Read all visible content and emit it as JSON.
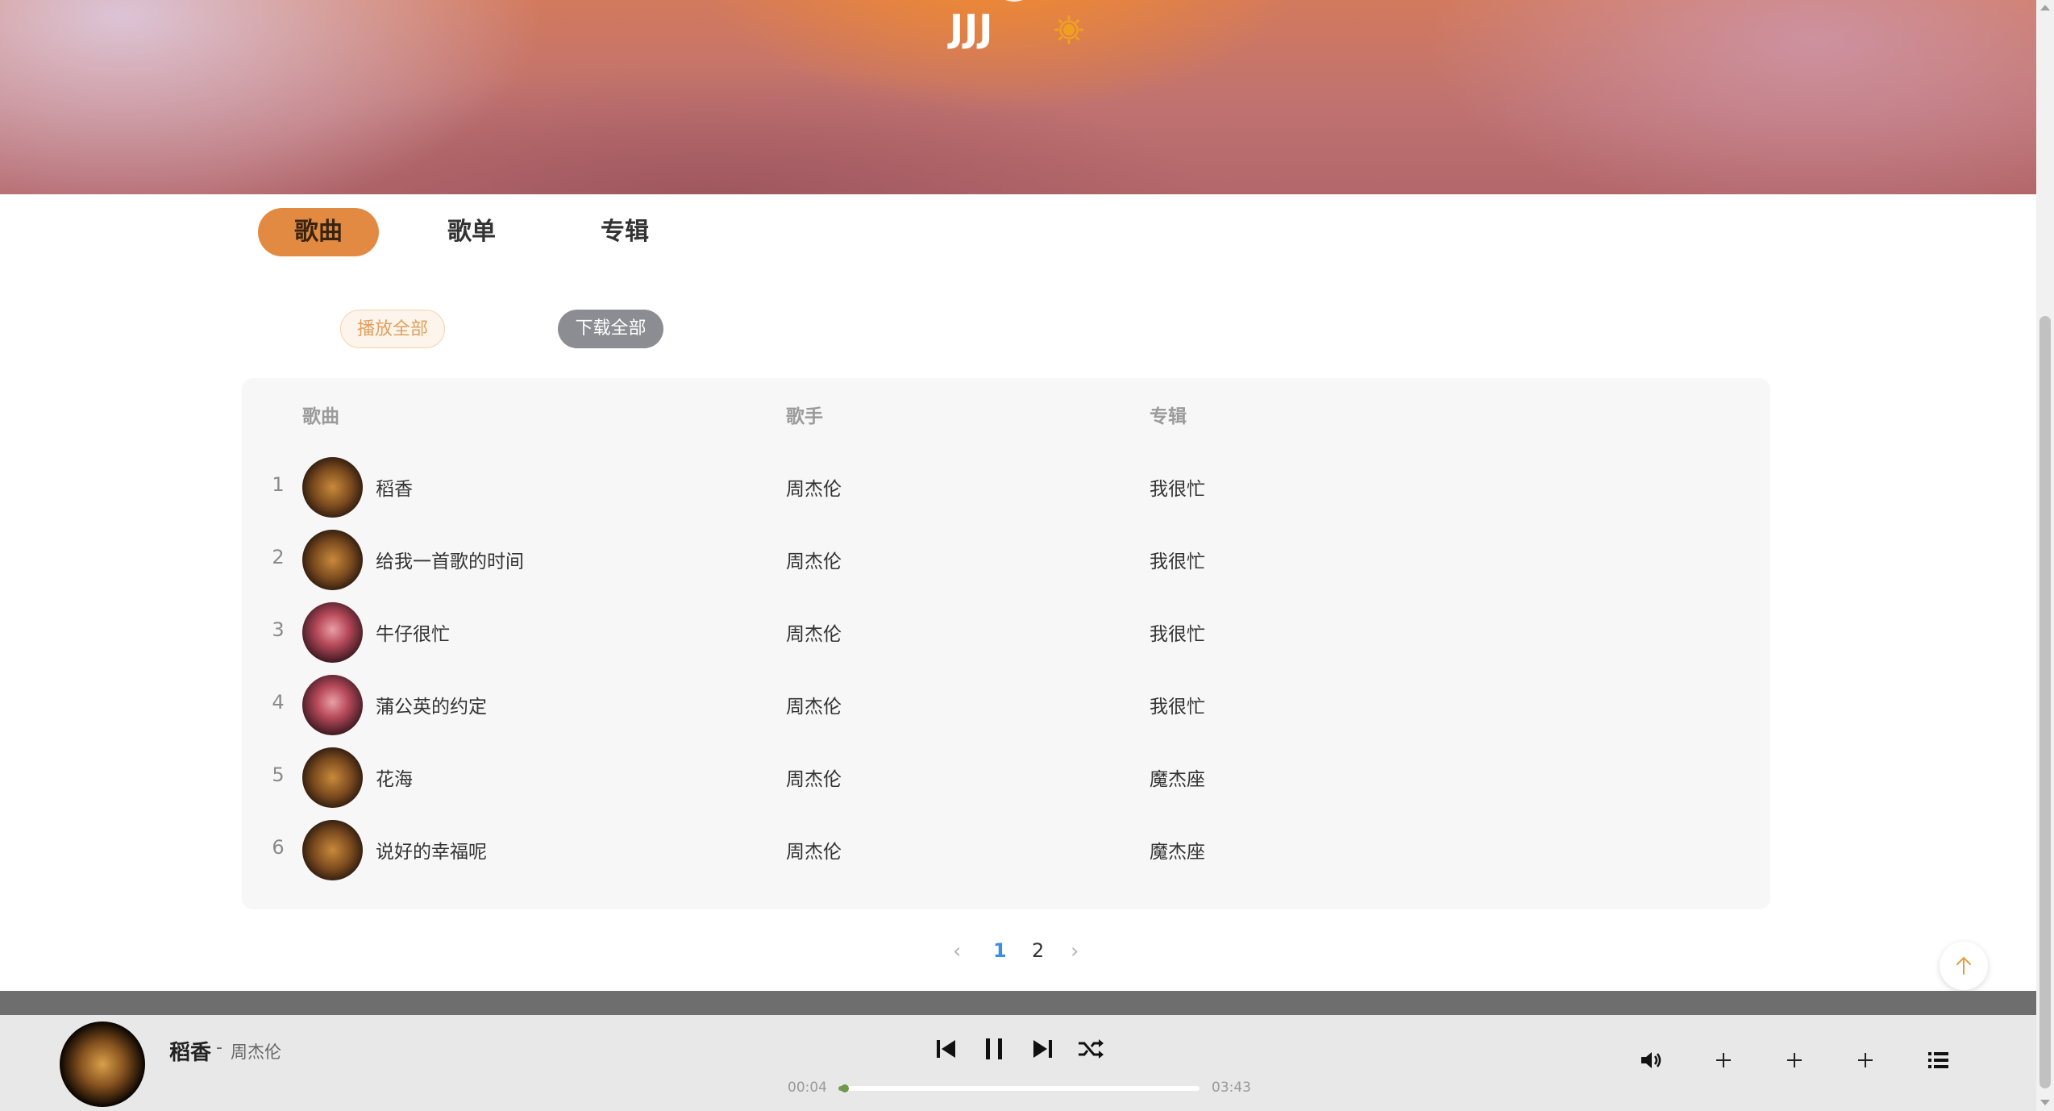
{
  "header": {
    "title": "JJJ"
  },
  "tabs": [
    {
      "label": "歌曲",
      "active": true
    },
    {
      "label": "歌单",
      "active": false
    },
    {
      "label": "专辑",
      "active": false
    }
  ],
  "actions": {
    "play_all": "播放全部",
    "download_all": "下载全部"
  },
  "table": {
    "headers": {
      "song": "歌曲",
      "singer": "歌手",
      "album": "专辑"
    },
    "rows": [
      {
        "index": "1",
        "name": "稻香",
        "singer": "周杰伦",
        "album": "我很忙"
      },
      {
        "index": "2",
        "name": "给我一首歌的时间",
        "singer": "周杰伦",
        "album": "我很忙"
      },
      {
        "index": "3",
        "name": "牛仔很忙",
        "singer": "周杰伦",
        "album": "我很忙"
      },
      {
        "index": "4",
        "name": "蒲公英的约定",
        "singer": "周杰伦",
        "album": "我很忙"
      },
      {
        "index": "5",
        "name": "花海",
        "singer": "周杰伦",
        "album": "魔杰座"
      },
      {
        "index": "6",
        "name": "说好的幸福呢",
        "singer": "周杰伦",
        "album": "魔杰座"
      }
    ]
  },
  "pagination": {
    "prev": "‹",
    "pages": [
      "1",
      "2"
    ],
    "current": "1",
    "next": "›"
  },
  "player": {
    "title": "稻香",
    "separator": "-",
    "artist": "周杰伦",
    "current_time": "00:04",
    "total_time": "03:43",
    "progress": 0.018
  },
  "colors": {
    "accent": "#e38a42",
    "icon_sun": "#f0a020",
    "active_page": "#3a8ee6"
  },
  "icons": {
    "theme": "sun-icon",
    "prev": "skip-previous-icon",
    "pause": "pause-icon",
    "next": "skip-next-icon",
    "shuffle": "shuffle-icon",
    "volume": "volume-icon",
    "add": "plus-icon",
    "playlist": "playlist-icon",
    "back_top": "arrow-up-icon"
  }
}
